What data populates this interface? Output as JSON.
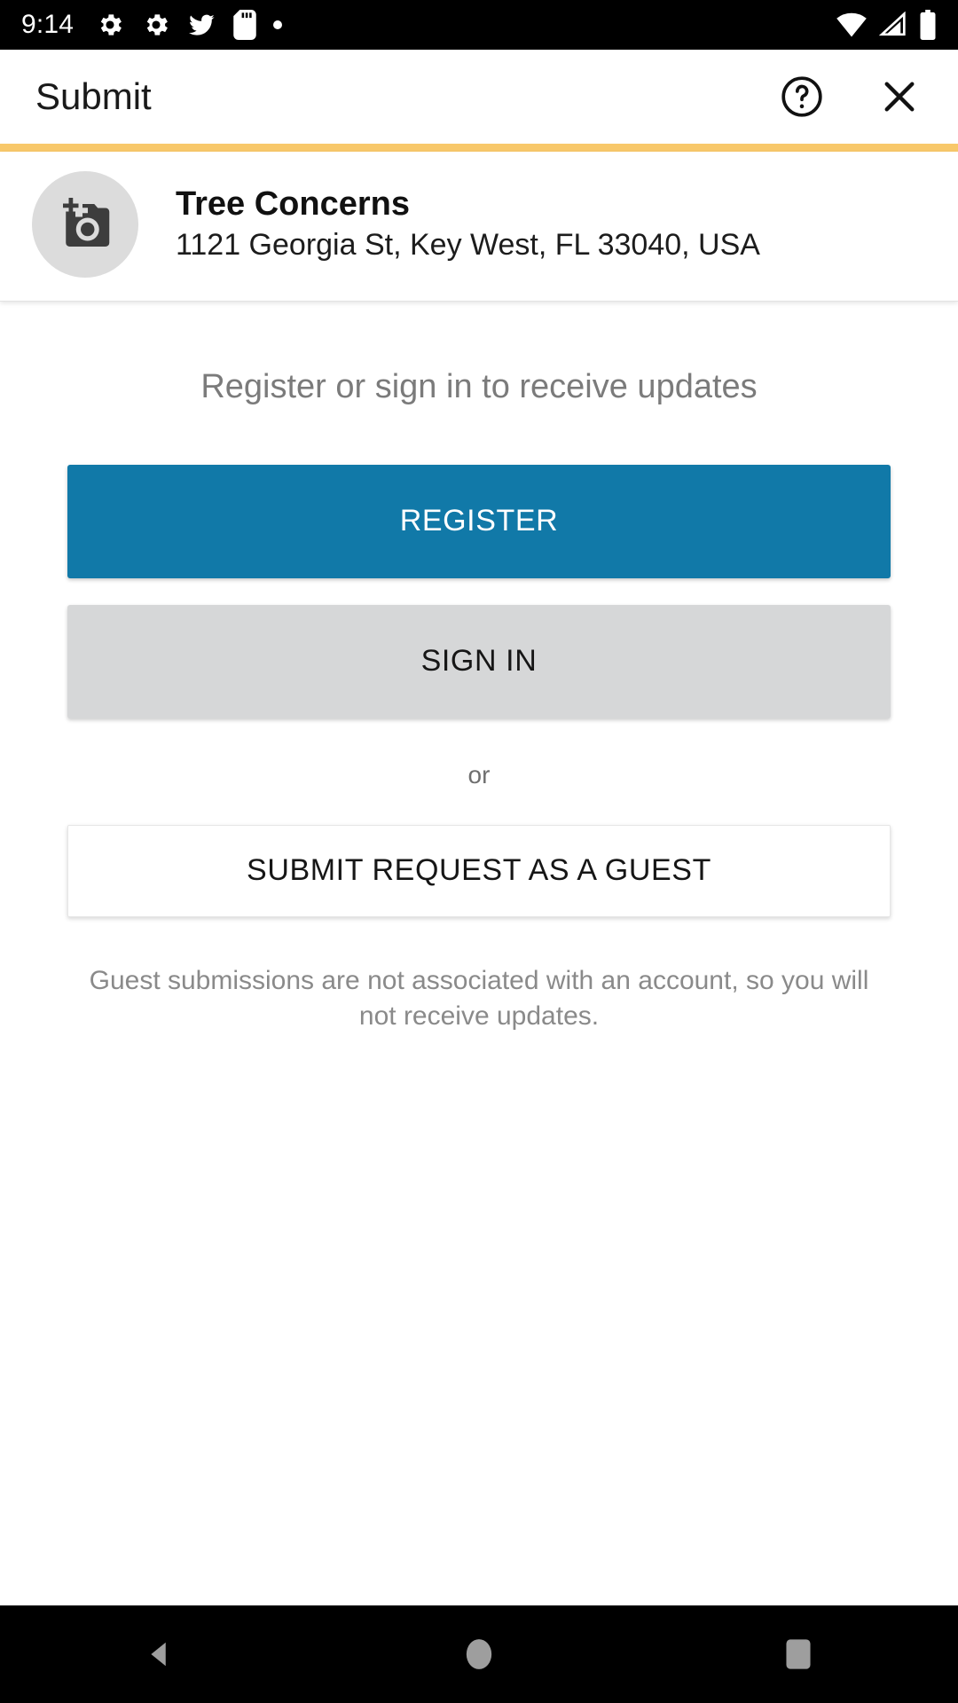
{
  "status_bar": {
    "clock": "9:14",
    "left_icons": [
      "gear-icon",
      "gear-icon",
      "bird-icon",
      "sd-card-icon",
      "dot-icon"
    ],
    "right_icons": [
      "wifi-icon",
      "cellular-signal-icon",
      "battery-icon"
    ],
    "background": "#000000"
  },
  "app_bar": {
    "title": "Submit",
    "help_icon": "help-circle-icon",
    "close_icon": "close-icon"
  },
  "accent": {
    "color": "#f8c86a"
  },
  "location_card": {
    "avatar_icon": "add-a-photo-icon",
    "title": "Tree Concerns",
    "address": "1121 Georgia St, Key West, FL 33040, USA"
  },
  "main": {
    "heading": "Register or sign in to receive updates",
    "register_label": "REGISTER",
    "register_color": "#1179a8",
    "signin_label": "SIGN IN",
    "signin_color": "#d6d7d8",
    "or_label": "or",
    "guest_label": "SUBMIT REQUEST AS A GUEST",
    "guest_note": "Guest submissions are not associated with an account, so you will not receive updates."
  },
  "nav_bar": {
    "back_icon": "back-triangle-icon",
    "home_icon": "home-circle-icon",
    "recents_icon": "recents-square-icon",
    "background": "#000000"
  }
}
